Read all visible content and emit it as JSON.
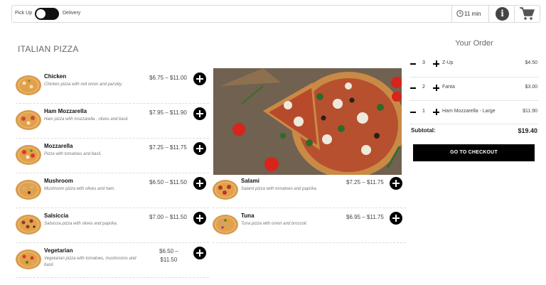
{
  "topbar": {
    "pickup_label": "Pick Up",
    "delivery_label": "Delivery",
    "delivery_time": "11 min",
    "icons": [
      "clock-icon",
      "info-icon",
      "cart-icon"
    ]
  },
  "menu": {
    "section_title": "ITALIAN PIZZA",
    "items": [
      {
        "name": "Chicken",
        "desc": "Chicken pizza with red onion and parsley.",
        "price": "$6.75 – $11.00"
      },
      {
        "name": "Ham Mozzarella",
        "desc": "Ham pizza with mozzarella , olives and basil.",
        "price": "$7.95 – $11.90"
      },
      {
        "name": "Mozzarella",
        "desc": "Pizza with tomatoes and basil.",
        "price": "$7.25 – $11.75"
      },
      {
        "name": "Mushroom",
        "desc": "Mushroom pizza with olives and ham.",
        "price": "$6.50 – $11.50"
      },
      {
        "name": "Salsiccia",
        "desc": "Salsiccia pizza with olives and paprika.",
        "price": "$7.00 – $11.50"
      },
      {
        "name": "Vegetarian",
        "desc": "Vegetarian pizza with tomatoes, mushrooms and basil.",
        "price_line1": "$6.50 –",
        "price_line2": "$11.50"
      },
      {
        "name": "Salami",
        "desc": "Salami pizza with tomatoes and paprika.",
        "price": "$7.25 – $11.75"
      },
      {
        "name": "Tuna",
        "desc": "Tuna pizza with onion and broccoli.",
        "price": "$6.95 – $11.75"
      }
    ]
  },
  "order": {
    "title": "Your Order",
    "lines": [
      {
        "qty": "3",
        "name": "Z-Up",
        "price": "$4.50"
      },
      {
        "qty": "2",
        "name": "Fanta",
        "price": "$3.00"
      },
      {
        "qty": "1",
        "name": "Ham Mozzarella - Large",
        "price": "$11.90"
      }
    ],
    "subtotal_label": "Subtotal:",
    "subtotal_value": "$19.40",
    "checkout_label": "GO TO CHECKOUT"
  },
  "colors": {
    "accent": "#000000",
    "border": "#d9d9d9",
    "pizza_crust": "#d9a25a",
    "tomato": "#c8281e"
  }
}
